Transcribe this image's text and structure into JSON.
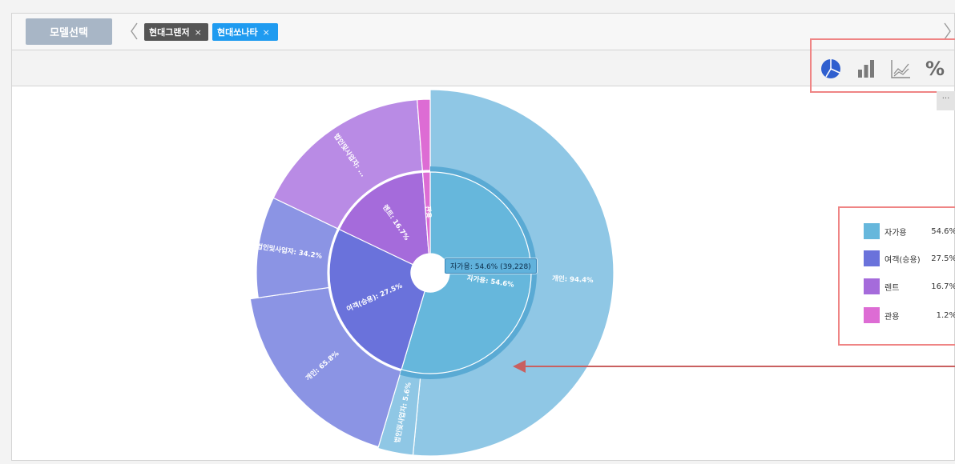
{
  "header": {
    "model_select_label": "모델선택",
    "tags": [
      {
        "label": "현대그랜저",
        "close": "×",
        "color": "#555555"
      },
      {
        "label": "현대쏘나타",
        "close": "×",
        "color": "#1f9bf0"
      }
    ]
  },
  "toolbar": {
    "tools": [
      "pie-chart-icon",
      "bar-chart-icon",
      "line-chart-icon",
      "percent-icon"
    ],
    "active_color": "#2f5fcf",
    "more_label": "..."
  },
  "tooltip": {
    "text": "자가용: 54.6% (39,228)"
  },
  "legend": [
    {
      "name": "자가용",
      "value": "54.6%",
      "color": "#66b7dc"
    },
    {
      "name": "여객(승용)",
      "value": "27.5%",
      "color": "#6a72db"
    },
    {
      "name": "렌트",
      "value": "16.7%",
      "color": "#a56bdb"
    },
    {
      "name": "관용",
      "value": "1.2%",
      "color": "#dd6cd4"
    }
  ],
  "chart_data": {
    "type": "pie",
    "subtype": "sunburst",
    "inner": [
      {
        "label": "자가용: 54.6%",
        "value": 54.6,
        "color": "#66b7dc"
      },
      {
        "label": "여객(승용): 27.5%",
        "value": 27.5,
        "color": "#6a72db"
      },
      {
        "label": "렌트: 16.7%",
        "value": 16.7,
        "color": "#a56bdb"
      },
      {
        "label": "관용",
        "value": 1.2,
        "color": "#dd6cd4"
      }
    ],
    "outer": [
      {
        "label": "개인: 94.4%",
        "value": 51.5,
        "color": "#8fc7e5"
      },
      {
        "label": "법인및사업자: 5.6%",
        "value": 3.1,
        "color": "#8fc7e5"
      },
      {
        "label": "개인: 65.8%",
        "value": 18.1,
        "color": "#8b94e4"
      },
      {
        "label": "법인및사업자: 34.2%",
        "value": 9.4,
        "color": "#8b94e4"
      },
      {
        "label": "법인및사업자: ...",
        "value": 16.7,
        "color": "#b98be5"
      },
      {
        "label": "",
        "value": 1.2,
        "color": "#dd6cd4"
      }
    ]
  }
}
